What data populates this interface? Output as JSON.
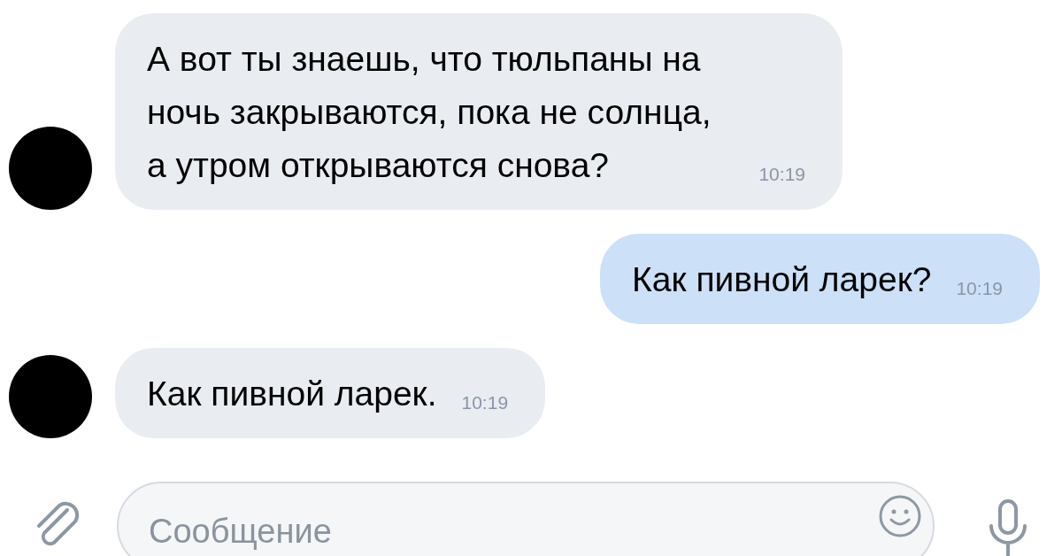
{
  "messages": [
    {
      "kind": "incoming",
      "text": "А вот ты знаешь, что тюльпаны на ночь закрываются, пока не солнца, а утром открываются снова?",
      "time": "10:19"
    },
    {
      "kind": "outgoing",
      "text": "Как пивной ларек?",
      "time": "10:19"
    },
    {
      "kind": "incoming",
      "text": "Как пивной ларек.",
      "time": "10:19"
    }
  ],
  "composer": {
    "placeholder": "Сообщение"
  }
}
